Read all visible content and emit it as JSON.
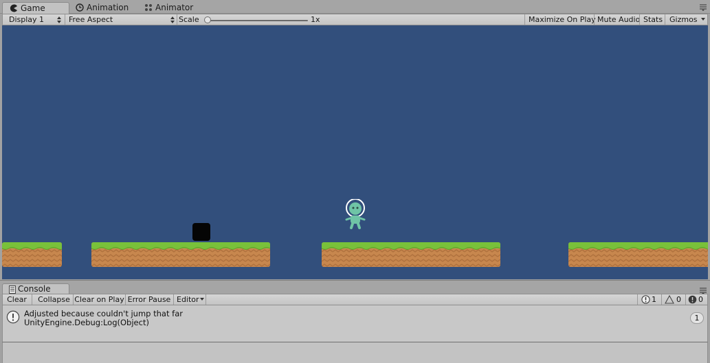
{
  "tabs": [
    {
      "label": "Game",
      "icon": "pacman-icon",
      "active": true
    },
    {
      "label": "Animation",
      "icon": "clock-icon",
      "active": false
    },
    {
      "label": "Animator",
      "icon": "animator-nodes-icon",
      "active": false
    }
  ],
  "game_toolbar": {
    "display": "Display 1",
    "aspect": "Free Aspect",
    "scale_label": "Scale",
    "scale_value": "1x",
    "maximize": "Maximize On Play",
    "mute": "Mute Audio",
    "stats": "Stats",
    "gizmos": "Gizmos"
  },
  "scene": {
    "background": "#324f7c",
    "grass": "#79c13a",
    "dirt": "#c7874e",
    "player_color": "#6fc4a6",
    "block_color": "#050505"
  },
  "console": {
    "tab_label": "Console",
    "clear": "Clear",
    "collapse": "Collapse",
    "clear_on_play": "Clear on Play",
    "error_pause": "Error Pause",
    "editor": "Editor",
    "info_count": "1",
    "warning_count": "0",
    "error_count": "0",
    "log_line1": "Adjusted because couldn't jump that far",
    "log_line2": "UnityEngine.Debug:Log(Object)",
    "log_count": "1"
  }
}
